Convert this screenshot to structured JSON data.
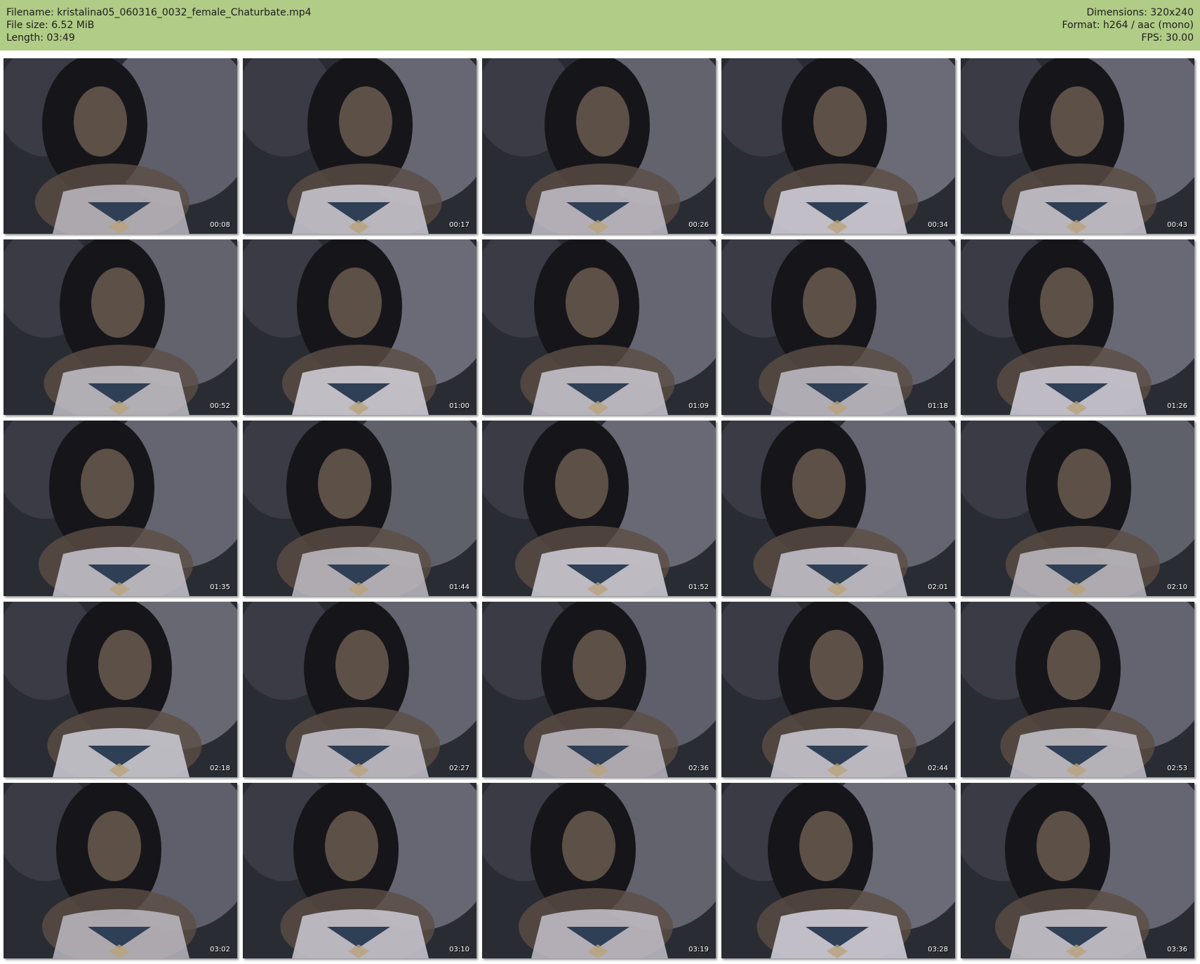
{
  "header": {
    "filename": "Filename: kristalina05_060316_0032_female_Chaturbate.mp4",
    "filesize": "File size: 6.52 MiB",
    "length": "Length: 03:49",
    "dimensions": "Dimensions: 320x240",
    "format": "Format: h264 / aac (mono)",
    "fps": "FPS: 30.00"
  },
  "thumbnails": [
    {
      "timestamp": "00:08"
    },
    {
      "timestamp": "00:17"
    },
    {
      "timestamp": "00:26"
    },
    {
      "timestamp": "00:34"
    },
    {
      "timestamp": "00:43"
    },
    {
      "timestamp": "00:52"
    },
    {
      "timestamp": "01:00"
    },
    {
      "timestamp": "01:09"
    },
    {
      "timestamp": "01:18"
    },
    {
      "timestamp": "01:26"
    },
    {
      "timestamp": "01:35"
    },
    {
      "timestamp": "01:44"
    },
    {
      "timestamp": "01:52"
    },
    {
      "timestamp": "02:01"
    },
    {
      "timestamp": "02:10"
    },
    {
      "timestamp": "02:18"
    },
    {
      "timestamp": "02:27"
    },
    {
      "timestamp": "02:36"
    },
    {
      "timestamp": "02:44"
    },
    {
      "timestamp": "02:53"
    },
    {
      "timestamp": "03:02"
    },
    {
      "timestamp": "03:10"
    },
    {
      "timestamp": "03:19"
    },
    {
      "timestamp": "03:28"
    },
    {
      "timestamp": "03:36"
    }
  ],
  "colors": {
    "header_background": "#b1cc86",
    "page_background": "#ffffff",
    "timestamp_text": "#ffffff"
  }
}
